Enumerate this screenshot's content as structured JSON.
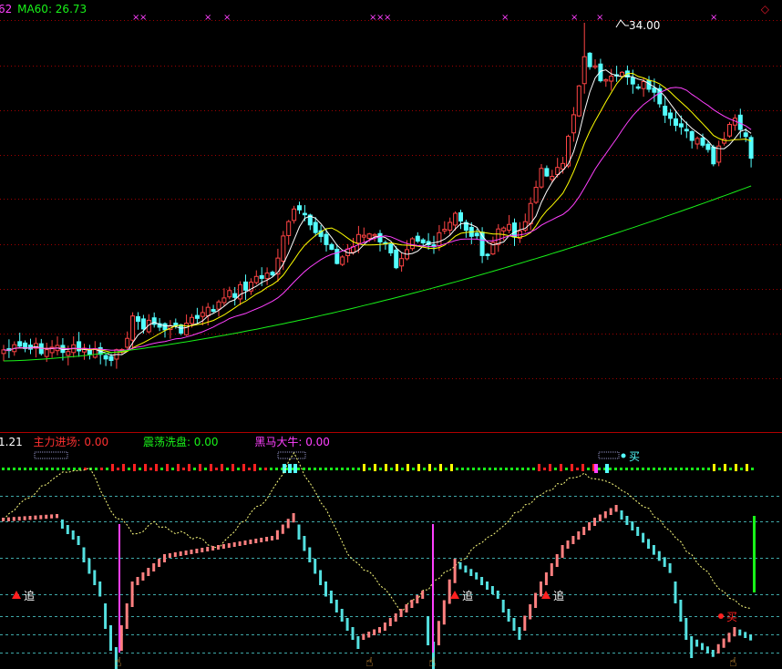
{
  "top_legend": {
    "prefix": "62",
    "ma60_label": "MA60: 26.73",
    "colors": {
      "prefix": "#ff40ff",
      "ma60": "#19f219"
    }
  },
  "corner_icon": "diamond-icon",
  "indicator_legend": {
    "prefix": "1.21",
    "zhuli": "主力进场: 0.00",
    "zhendang": "震荡洗盘: 0.00",
    "heima": "黑马大牛: 0.00",
    "colors": {
      "zhuli": "#ff3030",
      "zhendang": "#19f219",
      "heima": "#ff40ff",
      "prefix": "#ffffff"
    }
  },
  "price_chart": {
    "high_label": "34.00",
    "colors": {
      "up": "#ff4444",
      "down": "#54ffff",
      "ma5": "#ffffff",
      "ma10": "#ffff00",
      "ma20": "#ff40ff",
      "ma60": "#19f219",
      "grid": "#a00000"
    }
  },
  "signals": {
    "zhui": "追",
    "mai": "买",
    "colors": {
      "zhui": "#ff2020",
      "mai_bottom": "#ff2020",
      "mai_top": "#54ffff"
    }
  }
}
